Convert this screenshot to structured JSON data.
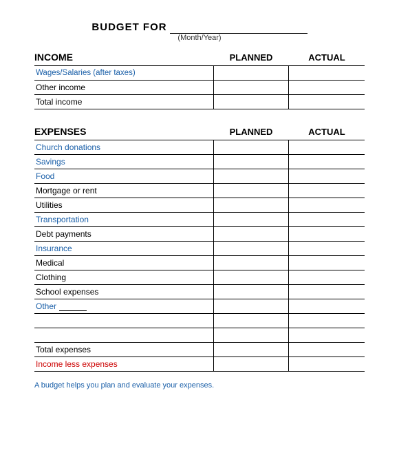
{
  "header": {
    "budget_for_label": "BUDGET FOR",
    "month_year_label": "(Month/Year)"
  },
  "income": {
    "section_title": "INCOME",
    "planned_header": "PLANNED",
    "actual_header": "ACTUAL",
    "rows": [
      {
        "label": "Wages/Salaries (after taxes)",
        "type": "blue"
      },
      {
        "label": "Other income",
        "type": "black"
      },
      {
        "label": "Total income",
        "type": "black"
      }
    ]
  },
  "expenses": {
    "section_title": "EXPENSES",
    "planned_header": "PLANNED",
    "actual_header": "ACTUAL",
    "rows": [
      {
        "label": "Church donations",
        "type": "blue"
      },
      {
        "label": "Savings",
        "type": "blue"
      },
      {
        "label": "Food",
        "type": "blue"
      },
      {
        "label": "Mortgage or rent",
        "type": "black"
      },
      {
        "label": "Utilities",
        "type": "black"
      },
      {
        "label": "Transportation",
        "type": "blue"
      },
      {
        "label": "Debt payments",
        "type": "black"
      },
      {
        "label": "Insurance",
        "type": "blue"
      },
      {
        "label": "Medical",
        "type": "black"
      },
      {
        "label": "Clothing",
        "type": "black"
      },
      {
        "label": "School expenses",
        "type": "black"
      },
      {
        "label": "Other",
        "type": "blue",
        "has_underline": true
      }
    ],
    "blank_rows": 2,
    "total_row": "Total expenses",
    "income_less_row": "Income less expenses"
  },
  "footer": {
    "note": "A budget helps you plan and evaluate your expenses."
  }
}
